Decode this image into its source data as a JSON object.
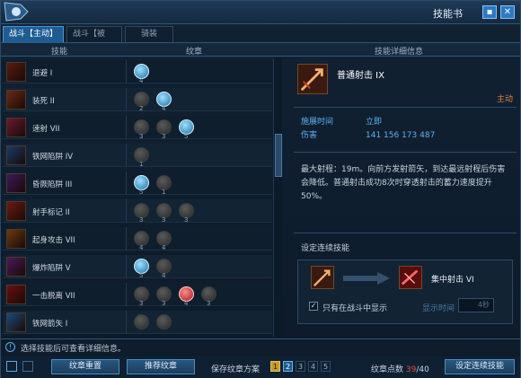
{
  "window": {
    "title": "技能书",
    "lock_icon": "lock-icon",
    "close_icon": "close-icon"
  },
  "tabs": [
    {
      "label": "战斗【主动】",
      "active": true
    },
    {
      "label": "战斗【被动】",
      "active": false
    },
    {
      "label": "骑装",
      "active": false
    }
  ],
  "columns": {
    "skill": "技能",
    "glyph": "纹章",
    "detail": "技能详细信息"
  },
  "skills": [
    {
      "name": "退避 I",
      "glyphs": [
        {
          "state": "on",
          "num": "4"
        }
      ]
    },
    {
      "name": "装死 II",
      "glyphs": [
        {
          "state": "off",
          "num": "2"
        },
        {
          "state": "on",
          "num": "4"
        }
      ]
    },
    {
      "name": "速射 VII",
      "glyphs": [
        {
          "state": "off",
          "num": "3"
        },
        {
          "state": "off",
          "num": "3"
        },
        {
          "state": "on",
          "num": "5"
        }
      ]
    },
    {
      "name": "铁网陷阱 IV",
      "glyphs": [
        {
          "state": "off",
          "num": "1"
        }
      ]
    },
    {
      "name": "昏厥陷阱 III",
      "glyphs": [
        {
          "state": "on",
          "num": "5"
        },
        {
          "state": "off",
          "num": "1"
        }
      ]
    },
    {
      "name": "射手标记 II",
      "glyphs": [
        {
          "state": "off",
          "num": "3"
        },
        {
          "state": "off",
          "num": "3"
        },
        {
          "state": "off",
          "num": "3"
        }
      ]
    },
    {
      "name": "起身攻击 VII",
      "glyphs": [
        {
          "state": "off",
          "num": "4"
        },
        {
          "state": "off",
          "num": "4"
        }
      ]
    },
    {
      "name": "爆炸陷阱 V",
      "glyphs": [
        {
          "state": "on",
          "num": "5"
        },
        {
          "state": "off",
          "num": "4"
        }
      ]
    },
    {
      "name": "一击脱离 VII",
      "glyphs": [
        {
          "state": "off",
          "num": "3"
        },
        {
          "state": "off",
          "num": "3"
        },
        {
          "state": "red",
          "num": "4"
        },
        {
          "state": "off",
          "num": "3"
        }
      ]
    },
    {
      "name": "铁网箭矢 I",
      "glyphs": [
        {
          "state": "off",
          "num": ""
        },
        {
          "state": "off",
          "num": ""
        }
      ]
    }
  ],
  "detail": {
    "skill_title": "普通射击 IX",
    "type_label": "主动",
    "stats": [
      {
        "key": "施展时间",
        "value": "立即"
      },
      {
        "key": "伤害",
        "value": "141 156 173 487"
      }
    ],
    "description": "最大射程：19m。向前方发射箭矢，到达最远射程后伤害会降低。普通射击成功8次时穿透射击的蓄力速度提升50%。",
    "combo_title": "设定连续技能",
    "combo_target": "集中射击 VI",
    "combo_checkbox_label": "只有在战斗中显示",
    "combo_time_label": "显示时间",
    "combo_time_value": "4秒"
  },
  "hint": "选择技能后可查看详细信息。",
  "footer": {
    "reset_glyph": "纹章重置",
    "recommend_glyph": "推荐纹章",
    "save_plan_label": "保存纹章方案",
    "plans": [
      "1",
      "2",
      "3",
      "4",
      "5"
    ],
    "points_label": "纹章点数",
    "points_used": "39",
    "points_total": "/40",
    "set_combo": "设定连续技能"
  }
}
